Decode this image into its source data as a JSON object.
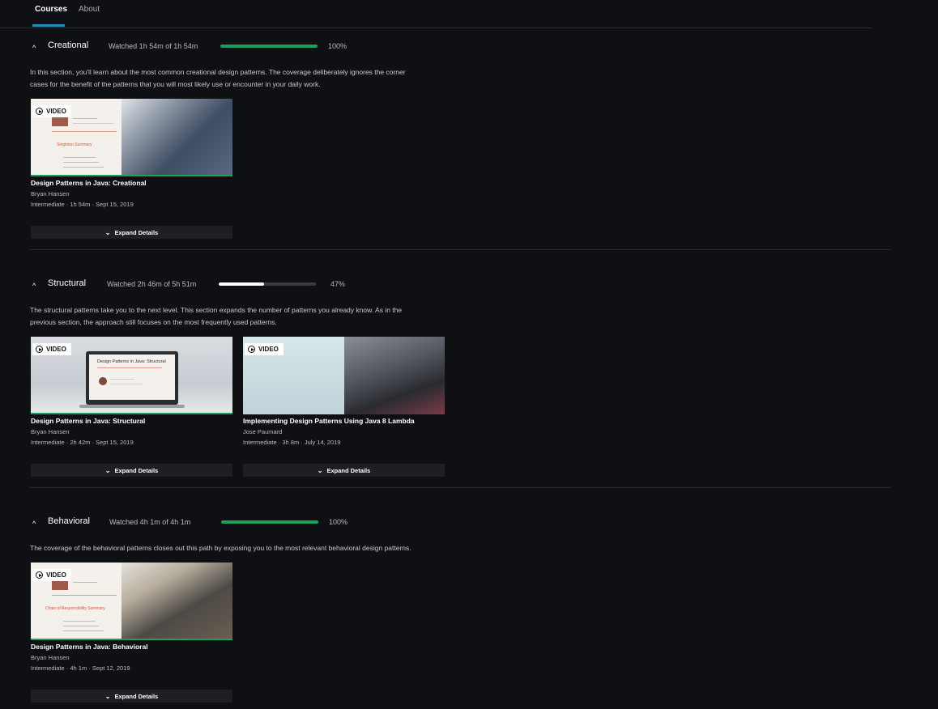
{
  "tabs": [
    {
      "label": "Courses",
      "active": true
    },
    {
      "label": "About",
      "active": false
    }
  ],
  "colors": {
    "progress_complete": "#18a05c",
    "progress_partial": "#ffffff",
    "progress_track": "#3a3b40",
    "tab_underline": "#1f8fc0"
  },
  "sections": [
    {
      "title": "Creational",
      "watched": "Watched 1h 54m of 1h 54m",
      "progress": 1.0,
      "percent": "100%",
      "description_1": "In this section, you'll learn about the most common creational design patterns. The coverage deliberately ignores the corner",
      "description_2": "cases for the benefit of the patterns that you will most likely use or encounter in your daily work.",
      "courses": [
        {
          "badge": "VIDEO",
          "title": "Design Patterns in Java: Creational",
          "author": "Bryan Hansen",
          "meta": "Intermediate  ·  1h 54m  ·  Sept 15, 2019",
          "expand": "Expand Details",
          "slide_text": "Singleton Summary",
          "progress": 1.0
        }
      ]
    },
    {
      "title": "Structural",
      "watched": "Watched 2h 46m of 5h 51m",
      "progress": 0.47,
      "percent": "47%",
      "description_1": "The structural patterns take you to the next level. This section expands the number of patterns you already know. As in the",
      "description_2": "previous section, the approach still focuses on the most frequently used patterns.",
      "courses": [
        {
          "badge": "VIDEO",
          "title": "Design Patterns in Java: Structural",
          "author": "Bryan Hansen",
          "meta": "Intermediate  ·  2h 42m  ·  Sept 15, 2019",
          "expand": "Expand Details",
          "slide_text": "Design Patterns in Java: Structural",
          "progress": 1.0
        },
        {
          "badge": "VIDEO",
          "title": "Implementing Design Patterns Using Java 8 Lambda",
          "author": "Jose Paumard",
          "meta": "Intermediate  ·  3h 8m  ·  July 14, 2019",
          "expand": "Expand Details",
          "progress": 0.0
        }
      ]
    },
    {
      "title": "Behavioral",
      "watched": "Watched 4h 1m of 4h 1m",
      "progress": 1.0,
      "percent": "100%",
      "description_1": "The coverage of the behavioral patterns closes out this path by exposing you to the most relevant behavioral design patterns.",
      "description_2": "",
      "courses": [
        {
          "badge": "VIDEO",
          "title": "Design Patterns in Java: Behavioral",
          "author": "Bryan Hansen",
          "meta": "Intermediate  ·  4h 1m  ·  Sept 12, 2019",
          "expand": "Expand Details",
          "slide_text": "Chain of Responsibility Summary",
          "progress": 1.0
        }
      ]
    }
  ]
}
